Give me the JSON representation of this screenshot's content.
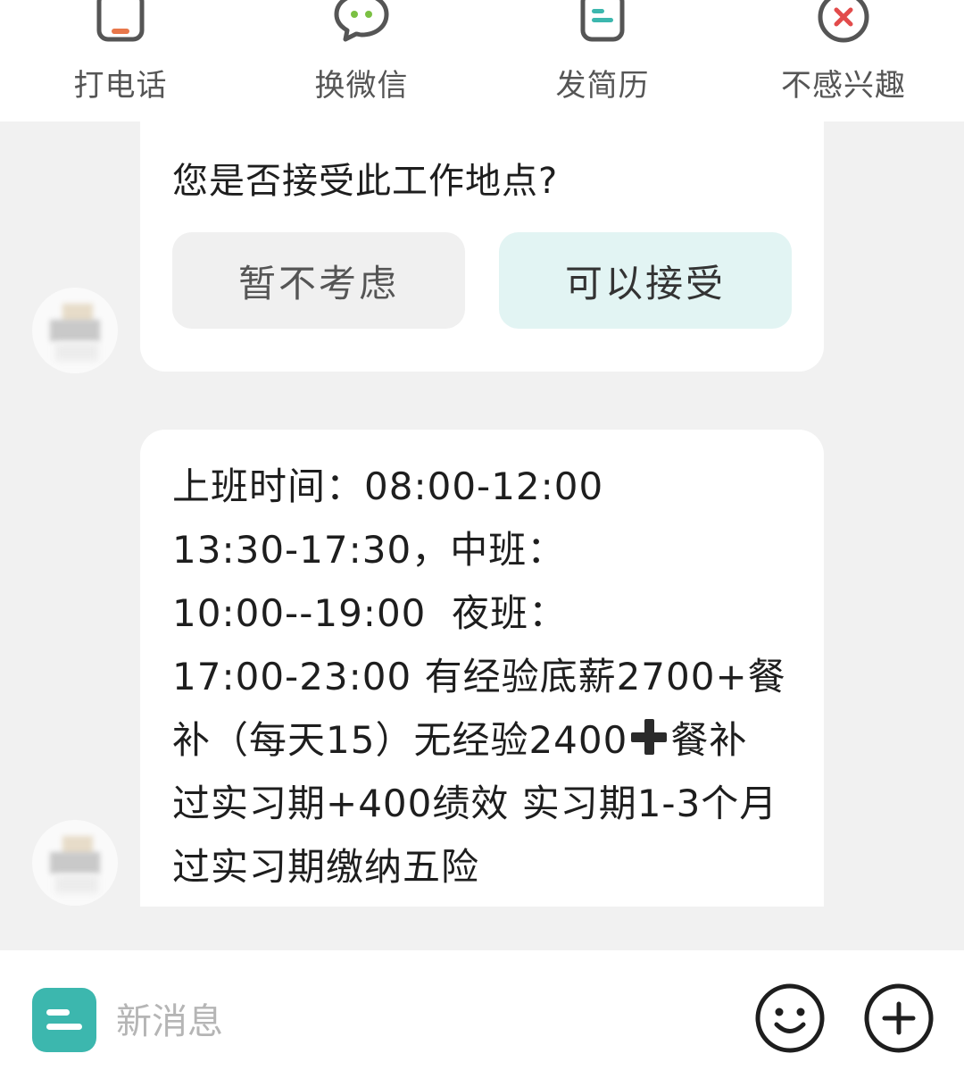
{
  "actions": [
    {
      "label": "打电话",
      "icon": "phone-icon"
    },
    {
      "label": "换微信",
      "icon": "wechat-icon"
    },
    {
      "label": "发简历",
      "icon": "resume-icon"
    },
    {
      "label": "不感兴趣",
      "icon": "not-interested-icon"
    }
  ],
  "location_card": {
    "question": "您是否接受此工作地点?",
    "decline_label": "暂不考虑",
    "accept_label": "可以接受"
  },
  "message": {
    "lines": [
      "上班时间：08:00-12:00",
      "13:30-17:30，中班：",
      "10:00--19:00  夜班：",
      "17:00-23:00 有经验底薪2700+餐",
      "补（每天15）无经验2400",
      "餐补",
      "过实习期+400绩效 实习期1-3个月",
      "过实习期缴纳五险"
    ]
  },
  "input": {
    "placeholder": "新消息",
    "emoji_icon": "smile-icon",
    "plus_icon": "plus-icon"
  },
  "colors": {
    "accent": "#3cb7ae",
    "accept_bg": "#e2f4f3",
    "decline_bg": "#f0f0f0",
    "close_red": "#e24b4b",
    "phone_orange": "#e8774a"
  }
}
